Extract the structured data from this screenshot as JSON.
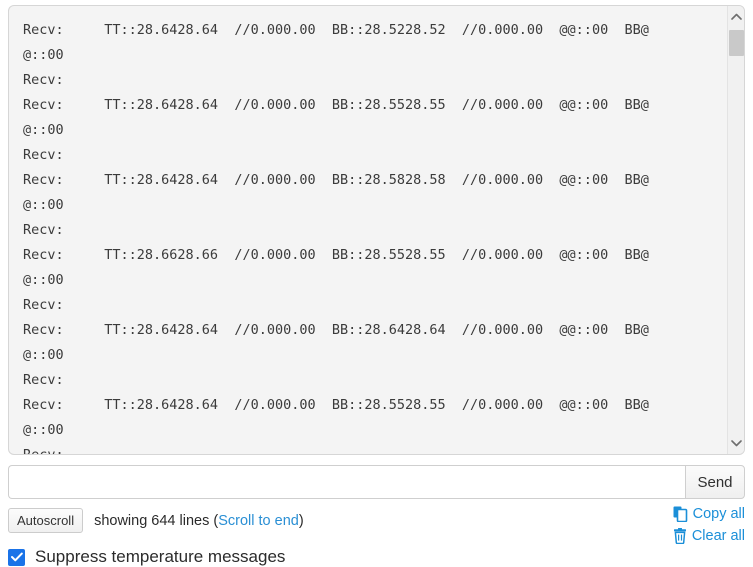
{
  "terminal": {
    "lines": [
      "Recv:     TT::28.6428.64  //0.000.00  BB::28.5228.52  //0.000.00  @@::00  BB@",
      "@::00",
      "Recv:",
      "Recv:     TT::28.6428.64  //0.000.00  BB::28.5528.55  //0.000.00  @@::00  BB@",
      "@::00",
      "Recv:",
      "Recv:     TT::28.6428.64  //0.000.00  BB::28.5828.58  //0.000.00  @@::00  BB@",
      "@::00",
      "Recv:",
      "Recv:     TT::28.6628.66  //0.000.00  BB::28.5528.55  //0.000.00  @@::00  BB@",
      "@::00",
      "Recv:",
      "Recv:     TT::28.6428.64  //0.000.00  BB::28.6428.64  //0.000.00  @@::00  BB@",
      "@::00",
      "Recv:",
      "Recv:     TT::28.6428.64  //0.000.00  BB::28.5528.55  //0.000.00  @@::00  BB@",
      "@::00",
      "Recv:"
    ],
    "scrollbar": {
      "up_arrow": "chevron-up-icon",
      "down_arrow": "chevron-down-icon"
    }
  },
  "send": {
    "input_value": "",
    "input_placeholder": "",
    "button_label": "Send"
  },
  "status": {
    "autoscroll_label": "Autoscroll",
    "showing_text": "showing 644 lines (",
    "scroll_to_end_label": "Scroll to end",
    "closing_paren": ")",
    "line_count": 644
  },
  "actions": {
    "copy_all_label": "Copy all",
    "clear_all_label": "Clear all"
  },
  "options": {
    "suppress_temperature_label": "Suppress temperature messages",
    "suppress_temperature_checked": true
  },
  "colors": {
    "link_blue": "#1b8fd8",
    "checkbox_blue": "#1a73e8",
    "log_bg": "#f4f4f4",
    "log_text": "#3b3b3b"
  }
}
